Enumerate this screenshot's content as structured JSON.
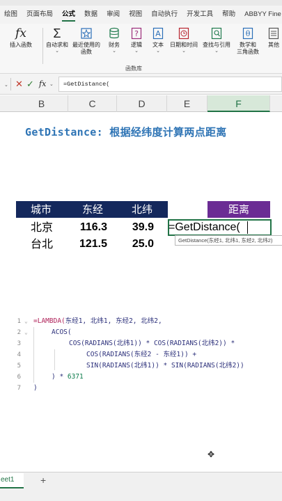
{
  "ribbon": {
    "tabs": [
      "绘图",
      "页面布局",
      "公式",
      "数据",
      "审阅",
      "视图",
      "自动执行",
      "开发工具",
      "帮助",
      "ABBYY Fine"
    ],
    "active_tab": "公式",
    "buttons": {
      "insert_function": "插入函数",
      "autosum": "自动求和",
      "recent": "最近使用的",
      "recent2": "函数",
      "financial": "财务",
      "logical": "逻辑",
      "text": "文本",
      "datetime": "日期和时间",
      "lookup": "查找与引用",
      "math": "数学和",
      "math2": "三角函数",
      "more": "其他"
    },
    "group_label": "函数库"
  },
  "formula_bar": {
    "value": "=GetDistance(",
    "cancel_glyph": "✕",
    "enter_glyph": "✓",
    "fx_glyph": "fx"
  },
  "columns": [
    "B",
    "C",
    "D",
    "E",
    "F"
  ],
  "selected_column": "F",
  "sheet": {
    "title": "GetDistance: 根据经纬度计算两点距离",
    "headers": [
      "城市",
      "东经",
      "北纬"
    ],
    "distance_header": "距离",
    "rows": [
      {
        "city": "北京",
        "lon": "116.3",
        "lat": "39.9"
      },
      {
        "city": "台北",
        "lon": "121.5",
        "lat": "25.0"
      }
    ],
    "active_cell_text": "=GetDistance(",
    "tooltip": "GetDistance(东经1, 北纬1, 东经2, 北纬2)"
  },
  "code": {
    "line_numbers": [
      "1",
      "2",
      "3",
      "4",
      "5",
      "6",
      "7"
    ],
    "l1a": "=LAMBDA(",
    "l1b": "东经1, 北纬1, 东经2, 北纬2,",
    "l2": "ACOS(",
    "l3": "COS(RADIANS(北纬1)) * COS(RADIANS(北纬2)) *",
    "l4": "COS(RADIANS(东经2 - 东经1)) +",
    "l5": "SIN(RADIANS(北纬1)) * SIN(RADIANS(北纬2))",
    "l6a": ") * ",
    "l6b": "6371",
    "l7": ")",
    "fold": "⌄"
  },
  "status": {
    "sheet_tab": "eet1",
    "add_sheet": "+"
  }
}
